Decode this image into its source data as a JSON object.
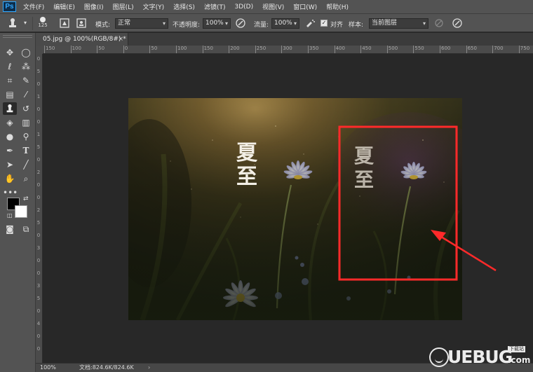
{
  "app": {
    "logo": "Ps"
  },
  "menu": [
    "文件(F)",
    "编辑(E)",
    "图像(I)",
    "图层(L)",
    "文字(Y)",
    "选择(S)",
    "滤镜(T)",
    "3D(D)",
    "视图(V)",
    "窗口(W)",
    "帮助(H)"
  ],
  "options": {
    "brush_size": "125",
    "mode_label": "模式:",
    "mode_value": "正常",
    "opacity_label": "不透明度:",
    "opacity_value": "100%",
    "flow_label": "流量:",
    "flow_value": "100%",
    "align_label": "对齐",
    "align_checked": true,
    "sample_label": "样本:",
    "sample_value": "当前图层"
  },
  "document": {
    "tab_title": "05.jpg @ 100%(RGB/8#) *",
    "close_glyph": "×"
  },
  "ruler": {
    "h_labels": [
      "150",
      "100",
      "50",
      "0",
      "50",
      "100",
      "150",
      "200",
      "250",
      "300",
      "350",
      "400",
      "450",
      "500",
      "550",
      "600",
      "650",
      "700",
      "750"
    ],
    "v_labels": [
      "0",
      "5",
      "0",
      "1",
      "0",
      "0",
      "1",
      "5",
      "0",
      "2",
      "0",
      "0",
      "2",
      "5",
      "0",
      "3",
      "0",
      "0",
      "3",
      "5",
      "0",
      "4",
      "0",
      "0"
    ]
  },
  "canvas_image": {
    "text_left": [
      "夏",
      "至"
    ],
    "text_right": [
      "夏",
      "至"
    ],
    "highlight_color": "#ff2a2a"
  },
  "status": {
    "zoom": "100%",
    "doc_info": "文档:824.6K/824.6K",
    "arrow": "›"
  },
  "watermark": {
    "text": "UEBUG",
    "com": ".com",
    "badge": "下载站"
  },
  "colors": {
    "foreground": "#000000",
    "background": "#ffffff",
    "accent": "#31a8ff"
  }
}
